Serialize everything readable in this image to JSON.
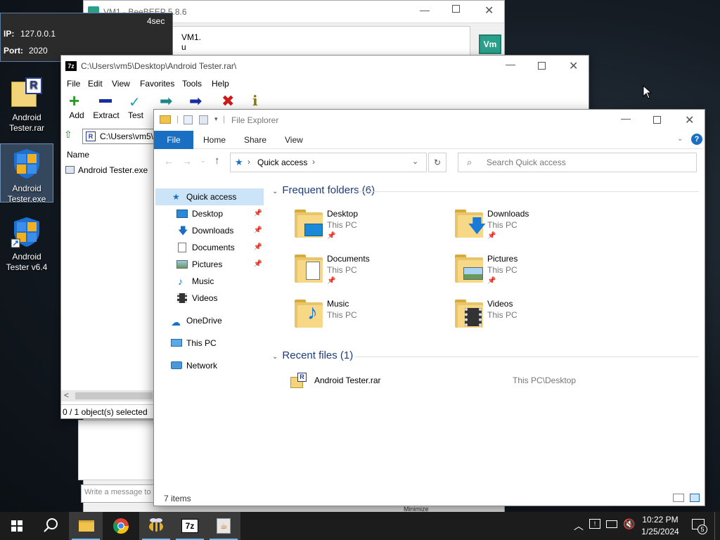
{
  "tooltip": {
    "timer": "4sec",
    "ip_label": "IP:",
    "ip_value": "127.0.0.1",
    "port_label": "Port:",
    "port_value": "2020"
  },
  "beebeep": {
    "title": "VM1 - BeeBEEP 5.8.6",
    "line1": "VM1.",
    "line2": "u",
    "avatar": "Vm",
    "message_placeholder": "Write a message to V",
    "minimize_label": "Minimize"
  },
  "desktop_icons": [
    {
      "label1": "Android",
      "label2": "Tester.rar"
    },
    {
      "label1": "Android",
      "label2": "Tester.exe"
    },
    {
      "label1": "Android",
      "label2": "Tester v6.4"
    }
  ],
  "sevenzip": {
    "title": "C:\\Users\\vm5\\Desktop\\Android Tester.rar\\",
    "menu": [
      "File",
      "Edit",
      "View",
      "Favorites",
      "Tools",
      "Help"
    ],
    "toolbar": [
      "Add",
      "Extract",
      "Test"
    ],
    "path": "C:\\Users\\vm5\\",
    "column_name": "Name",
    "file": "Android Tester.exe",
    "status": "0 / 1 object(s) selected",
    "logo": "7z"
  },
  "explorer": {
    "title": "File Explorer",
    "ribbon_tabs": [
      "File",
      "Home",
      "Share",
      "View"
    ],
    "address": "Quick access",
    "search_placeholder": "Search Quick access",
    "nav": {
      "quick_access": "Quick access",
      "items": [
        "Desktop",
        "Downloads",
        "Documents",
        "Pictures",
        "Music",
        "Videos"
      ],
      "onedrive": "OneDrive",
      "this_pc": "This PC",
      "network": "Network"
    },
    "frequent_header": "Frequent folders (6)",
    "folders": [
      {
        "name": "Desktop",
        "loc": "This PC"
      },
      {
        "name": "Downloads",
        "loc": "This PC"
      },
      {
        "name": "Documents",
        "loc": "This PC"
      },
      {
        "name": "Pictures",
        "loc": "This PC"
      },
      {
        "name": "Music",
        "loc": "This PC"
      },
      {
        "name": "Videos",
        "loc": "This PC"
      }
    ],
    "recent_header": "Recent files (1)",
    "recent": {
      "name": "Android Tester.rar",
      "path": "This PC\\Desktop"
    },
    "status": "7 items"
  },
  "taskbar": {
    "time": "10:22 PM",
    "date": "1/25/2024",
    "notifications": "5"
  },
  "colors": {
    "accent": "#1a6fc2",
    "folder": "#f6d886",
    "taskbar": "#1c1c1c"
  }
}
